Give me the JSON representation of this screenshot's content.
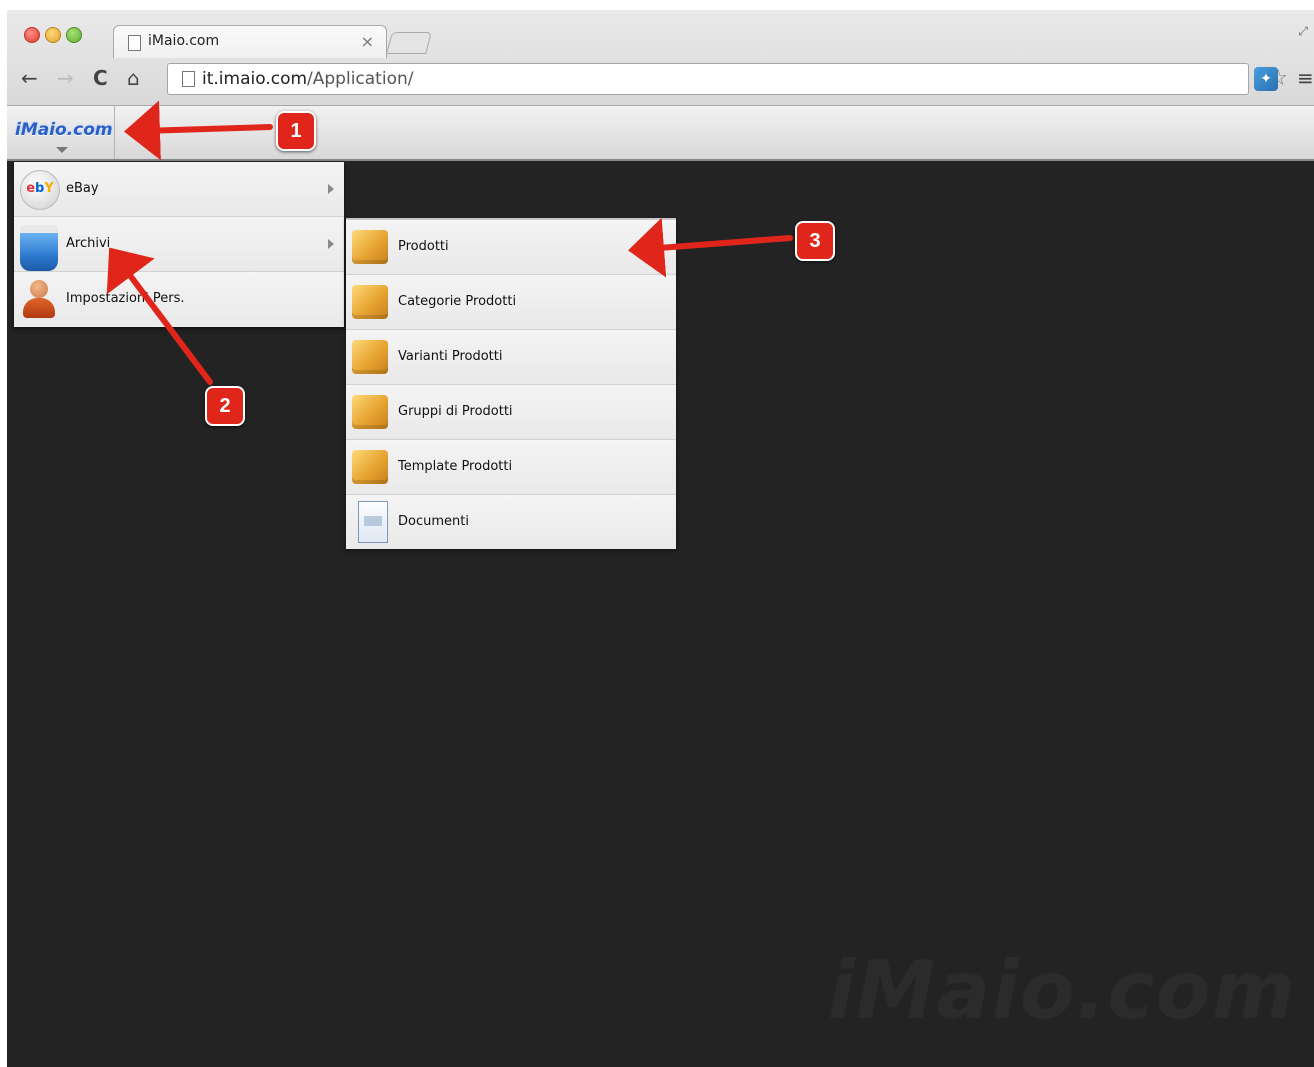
{
  "browser": {
    "tab_title": "iMaio.com",
    "tab_close": "×",
    "url_host": "it.imaio.com",
    "url_path": "/Application/",
    "icons": {
      "back": "back-arrow-icon",
      "forward": "forward-arrow-icon",
      "reload": "reload-icon",
      "home": "home-icon",
      "bookmark": "star-icon",
      "extension": "extension-icon",
      "menu": "hamburger-menu-icon"
    }
  },
  "app": {
    "logo": "iMaio.com",
    "watermark": "iMaio.com"
  },
  "main_menu": {
    "items": [
      {
        "label": "eBay",
        "icon": "ebay-icon",
        "has_submenu": true
      },
      {
        "label": "Archivi",
        "icon": "archive-icon",
        "has_submenu": true
      },
      {
        "label": "Impostazioni Pers.",
        "icon": "user-icon",
        "has_submenu": false
      }
    ]
  },
  "sub_menu": {
    "items": [
      {
        "label": "Prodotti",
        "icon": "box-icon"
      },
      {
        "label": "Categorie Prodotti",
        "icon": "box-icon"
      },
      {
        "label": "Varianti Prodotti",
        "icon": "box-icon"
      },
      {
        "label": "Gruppi di Prodotti",
        "icon": "box-icon"
      },
      {
        "label": "Template Prodotti",
        "icon": "box-icon"
      },
      {
        "label": "Documenti",
        "icon": "document-icon"
      }
    ]
  },
  "annotations": {
    "badges": [
      "1",
      "2",
      "3"
    ],
    "color": "#e0261b"
  }
}
